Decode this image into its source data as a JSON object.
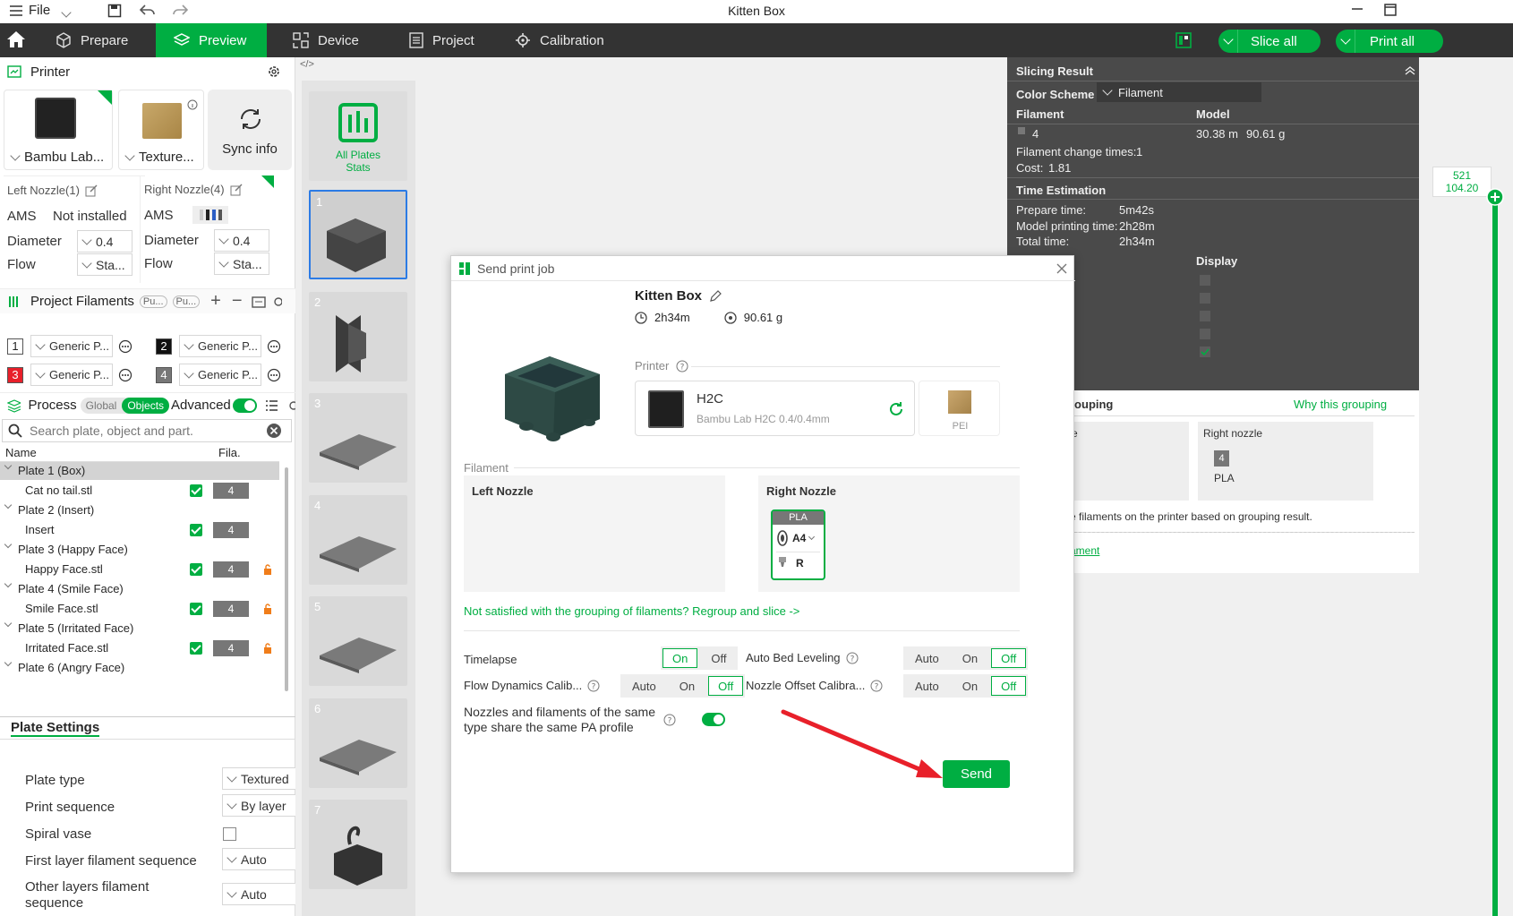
{
  "window": {
    "title": "Kitten Box",
    "file_menu": "File"
  },
  "nav": {
    "tabs": [
      {
        "label": "Prepare"
      },
      {
        "label": "Preview"
      },
      {
        "label": "Device"
      },
      {
        "label": "Project"
      },
      {
        "label": "Calibration"
      }
    ],
    "slice_all": "Slice all",
    "print_all": "Print all"
  },
  "printer": {
    "title": "Printer",
    "printer_name": "Bambu Lab...",
    "plate_name": "Texture...",
    "sync_info": "Sync info",
    "left_nozzle": {
      "label": "Left Nozzle(1)",
      "ams_label": "AMS",
      "ams_value": "Not installed",
      "diameter_label": "Diameter",
      "diameter": "0.4",
      "flow_label": "Flow",
      "flow": "Sta..."
    },
    "right_nozzle": {
      "label": "Right Nozzle(4)",
      "ams_label": "AMS",
      "diameter_label": "Diameter",
      "diameter": "0.4",
      "flow_label": "Flow",
      "flow": "Sta..."
    }
  },
  "filaments": {
    "title": "Project Filaments",
    "pill1": "Pu...",
    "pill2": "Pu...",
    "items": [
      {
        "num": "1",
        "name": "Generic P...",
        "color": "#ffffff",
        "text": "#222"
      },
      {
        "num": "2",
        "name": "Generic P...",
        "color": "#111111",
        "text": "#fff"
      },
      {
        "num": "3",
        "name": "Generic P...",
        "color": "#e8202a",
        "text": "#fff"
      },
      {
        "num": "4",
        "name": "Generic P...",
        "color": "#777777",
        "text": "#fff"
      }
    ]
  },
  "process": {
    "title": "Process",
    "global": "Global",
    "objects": "Objects",
    "advanced": "Advanced",
    "search_placeholder": "Search plate, object and part.",
    "col_name": "Name",
    "col_fila": "Fila.",
    "tree": [
      {
        "label": "Plate 1 (Box)",
        "type": "plate"
      },
      {
        "label": "Cat no tail.stl",
        "type": "obj",
        "fila": "4",
        "lock": false
      },
      {
        "label": "Plate 2 (Insert)",
        "type": "plate"
      },
      {
        "label": "Insert",
        "type": "obj",
        "fila": "4",
        "lock": false
      },
      {
        "label": "Plate 3 (Happy Face)",
        "type": "plate"
      },
      {
        "label": "Happy Face.stl",
        "type": "obj",
        "fila": "4",
        "lock": true
      },
      {
        "label": "Plate 4 (Smile Face)",
        "type": "plate"
      },
      {
        "label": "Smile Face.stl",
        "type": "obj",
        "fila": "4",
        "lock": true
      },
      {
        "label": "Plate 5 (Irritated Face)",
        "type": "plate"
      },
      {
        "label": "Irritated Face.stl",
        "type": "obj",
        "fila": "4",
        "lock": true
      },
      {
        "label": "Plate 6 (Angry Face)",
        "type": "plate"
      }
    ]
  },
  "plate_settings": {
    "title": "Plate Settings",
    "plate_type_label": "Plate type",
    "plate_type": "Textured",
    "print_seq_label": "Print sequence",
    "print_seq": "By layer",
    "spiral_label": "Spiral vase",
    "first_layer_label": "First layer filament sequence",
    "first_layer": "Auto",
    "other_layers_label": "Other layers filament sequence",
    "other_layers": "Auto"
  },
  "plates": {
    "all_stats": "All Plates Stats",
    "numbers": [
      "1",
      "2",
      "3",
      "4",
      "5",
      "6",
      "7"
    ]
  },
  "slicing": {
    "title": "Slicing Result",
    "color_scheme_label": "Color Scheme",
    "color_scheme": "Filament",
    "col_filament": "Filament",
    "col_model": "Model",
    "filament_id": "4",
    "length": "30.38 m",
    "weight": "90.61 g",
    "change_times_label": "Filament change times:",
    "change_times": "1",
    "cost_label": "Cost:",
    "cost": "1.81",
    "time_title": "Time Estimation",
    "prepare_label": "Prepare time:",
    "prepare": "5m42s",
    "model_time_label": "Model printing time:",
    "model_time": "2h28m",
    "total_label": "Total time:",
    "total": "2h34m",
    "display": "Display",
    "partial_ct": "ct",
    "grouping_title": "rouping",
    "why_grouping": "Why this grouping",
    "left_nozzle_partial": "e",
    "right_nozzle": "Right nozzle",
    "right_fila": "4",
    "right_type": "PLA",
    "group_note": "e filaments on the printer based on grouping result.",
    "link_partial": "ament"
  },
  "layer_slider": {
    "top_line1": "521",
    "top_line2": "104.20"
  },
  "dialog": {
    "title": "Send print job",
    "project_name": "Kitten Box",
    "time": "2h34m",
    "weight": "90.61 g",
    "printer_label": "Printer",
    "printer_model": "H2C",
    "printer_detail": "Bambu Lab H2C  0.4/0.4mm",
    "plate_label": "PEI",
    "filament_label": "Filament",
    "left_nozzle": "Left Nozzle",
    "right_nozzle": "Right Nozzle",
    "fil_type": "PLA",
    "fil_slot": "A4",
    "fil_nozzle": "R",
    "regroup_link": "Not satisfied with the grouping of filaments? Regroup and slice ->",
    "timelapse": "Timelapse",
    "on": "On",
    "off": "Off",
    "auto": "Auto",
    "auto_bed": "Auto Bed Leveling",
    "flow_dyn": "Flow Dynamics Calib...",
    "nozzle_offset": "Nozzle Offset Calibra...",
    "pa_profile": "Nozzles and filaments of the same type share the same PA profile",
    "send": "Send"
  },
  "colors": {
    "accent": "#00ae42",
    "dark": "#333333",
    "model": "#2e4a45",
    "arrow": "#e8202a"
  }
}
